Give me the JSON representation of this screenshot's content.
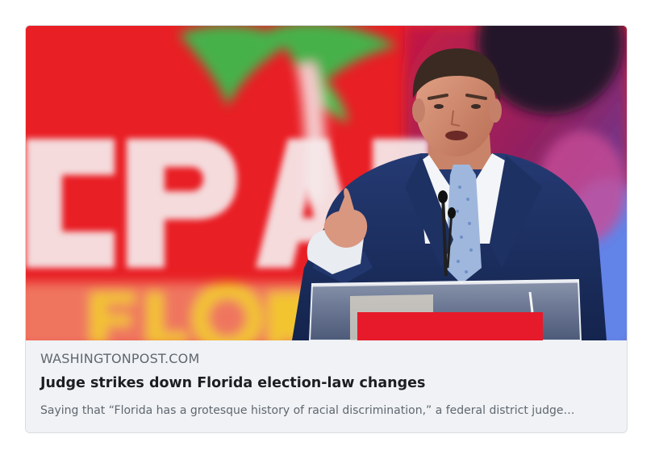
{
  "link_preview": {
    "image_icon": "news-photo",
    "domain": "WASHINGTONPOST.COM",
    "headline": "Judge strikes down Florida election-law changes",
    "description": "Saying that “Florida has a grotesque history of racial discrimination,” a federal district judge…",
    "colors": {
      "card_background": "#f0f2f5",
      "card_border": "#dadde1",
      "domain_text": "#606770",
      "headline_text": "#1c1e21",
      "description_text": "#606770"
    }
  }
}
